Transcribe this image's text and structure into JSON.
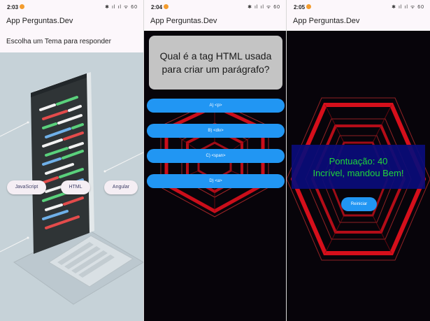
{
  "app_title": "App Perguntas.Dev",
  "screens": [
    {
      "status": {
        "time": "2:03",
        "icons": "✱ ıl ıl ᯤ 60"
      },
      "subtitle": "Escolha um Tema para responder",
      "themes": [
        "JavaScript",
        "HTML",
        "Angular"
      ]
    },
    {
      "status": {
        "time": "2:04",
        "icons": "✱ ıl ıl ᯤ 60"
      },
      "question": "Qual é a tag HTML usada para criar um parágrafo?",
      "answers": [
        "A) <p>",
        "B) <div>",
        "C) <span>",
        "D) <a>"
      ]
    },
    {
      "status": {
        "time": "2:05",
        "icons": "✱ ıl ıl ᯤ 60"
      },
      "score_text": "Pontuação: 40",
      "praise_text": "Incrível, mandou Bem!",
      "restart_label": "Reiniciar"
    }
  ],
  "colors": {
    "accent": "#2196f3",
    "success_text": "#20e640",
    "neon_red": "#e0101c",
    "dark_bg": "#07040a"
  }
}
